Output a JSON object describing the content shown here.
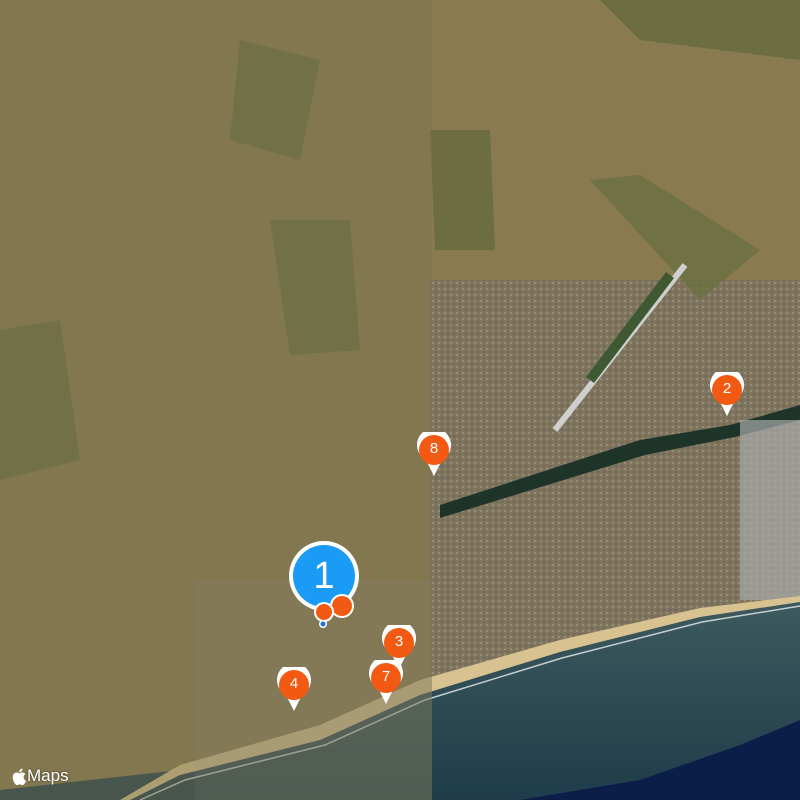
{
  "map": {
    "provider_label": "Maps",
    "provider_icon": "apple-logo-icon",
    "colors": {
      "pin": "#f25a13",
      "cluster": "#1a9bf5",
      "terrain_dimmed": "#736a48",
      "terrain": "#8a7a52",
      "ocean": "#294a52",
      "deep_ocean": "#0b1e4a",
      "beach": "#d8c28f"
    }
  },
  "markers": [
    {
      "label": "1",
      "kind": "cluster"
    },
    {
      "label": "2",
      "kind": "pin"
    },
    {
      "label": "3",
      "kind": "pin"
    },
    {
      "label": "4",
      "kind": "pin"
    },
    {
      "label": "7",
      "kind": "pin"
    },
    {
      "label": "8",
      "kind": "pin"
    }
  ]
}
